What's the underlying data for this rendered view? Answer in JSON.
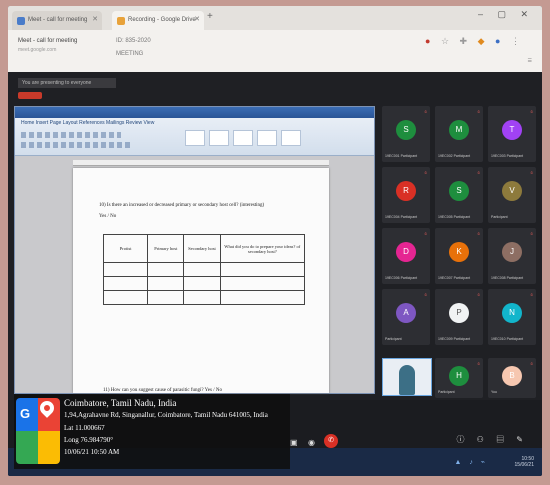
{
  "browser": {
    "tabs": [
      {
        "label": "Meet - call for meeting"
      },
      {
        "label": "Recording - Google Drive"
      }
    ],
    "new_tab": "+",
    "window_controls": "– ▢ ✕",
    "meeting_code_label": "Meet - call for meeting",
    "meeting_subtitle": "meet.google.com",
    "url_line_1": "ID: 835-2020",
    "url_line_2": "MEETING",
    "notice": "You are presenting to everyone"
  },
  "document": {
    "ribbon_tabs": "Home  Insert  Page Layout  References  Mailings  Review  View",
    "question_1": "10) Is there an increased or decreased primary or secondary host cell? (interesting)",
    "answer_1": "Yes / No",
    "table_headers": [
      "Protist",
      "Primary host",
      "Secondary host",
      "What did you do to prepare your ideas? of secondary host?"
    ],
    "table_rows": [
      [
        "",
        "",
        "",
        ""
      ],
      [
        "",
        "",
        "",
        ""
      ],
      [
        "",
        "",
        "",
        ""
      ]
    ],
    "question_2": "11) How can you suggest cause of parasitic fungi?  Yes / No"
  },
  "participants": [
    {
      "initial": "S",
      "name": "19EC001 Participant",
      "color": "#1e8e3e"
    },
    {
      "initial": "M",
      "name": "19EC002 Participant",
      "color": "#1e8e3e"
    },
    {
      "initial": "T",
      "name": "19EC003 Participant",
      "color": "#a142f4"
    },
    {
      "initial": "R",
      "name": "19EC004 Participant",
      "color": "#d93025"
    },
    {
      "initial": "S",
      "name": "19EC005 Participant",
      "color": "#1e8e3e"
    },
    {
      "initial": "V",
      "name": "Participant",
      "color": "#8d7a3c"
    },
    {
      "initial": "D",
      "name": "19EC006 Participant",
      "color": "#e52592"
    },
    {
      "initial": "K",
      "name": "19EC007 Participant",
      "color": "#e8710a"
    },
    {
      "initial": "J",
      "name": "19EC008 Participant",
      "color": "#8d6e63"
    },
    {
      "initial": "A",
      "name": "Participant",
      "color": "#7e57c2"
    },
    {
      "initial": "P",
      "name": "19EC009 Participant",
      "color": "#f1f3f4"
    },
    {
      "initial": "N",
      "name": "19EC010 Participant",
      "color": "#12b5cb"
    },
    {
      "initial": "H",
      "name": "Participant",
      "color": "#1e8e3e"
    },
    {
      "initial": "B",
      "name": "You",
      "color": "#f6c7b0"
    }
  ],
  "controls": {
    "hangup_icon": "✆",
    "right_icons": "ⓘ ⚇ ▤ ✎"
  },
  "taskbar": {
    "time": "10:50",
    "date": "15/06/21"
  },
  "gps_overlay": {
    "title": "Coimbatore, Tamil Nadu, India",
    "address": "1,94,Agrahavne Rd, Singanallur, Coimbatore, Tamil Nadu 641005, India",
    "lat": "Lat 11.000667",
    "long": "Long 76.984790°",
    "timestamp": "10/06/21 10:50 AM"
  }
}
